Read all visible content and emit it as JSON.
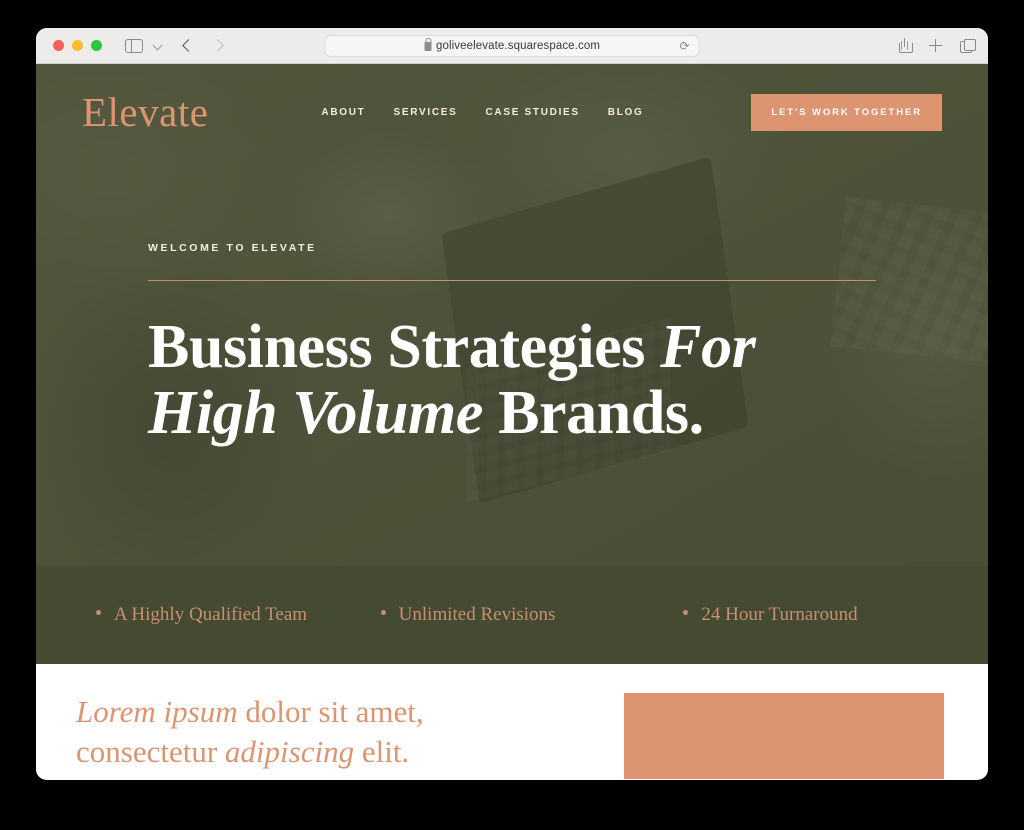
{
  "browser": {
    "traffic_lights": [
      "close",
      "minimize",
      "maximize"
    ],
    "sidebar_toggle": "sidebar-icon",
    "tab_overview_chevron": "chevron-down-icon",
    "back": "back-arrow-icon",
    "forward": "forward-arrow-icon",
    "url": "goliveelevate.squarespace.com",
    "lock": "lock-icon",
    "reload": "⟳",
    "share": "share-icon",
    "new_tab": "plus-icon",
    "tabs": "tab-overview-icon"
  },
  "site": {
    "brand": "Elevate",
    "nav": [
      {
        "label": "ABOUT"
      },
      {
        "label": "SERVICES"
      },
      {
        "label": "CASE STUDIES"
      },
      {
        "label": "BLOG"
      }
    ],
    "cta": "LET'S WORK TOGETHER",
    "hero": {
      "eyebrow": "WELCOME TO ELEVATE",
      "headline_part1": "Business Strategies ",
      "headline_italic1": "For",
      "headline_italic2": "High Volume",
      "headline_part2": " Brands."
    },
    "features": [
      {
        "label": "A Highly Qualified Team"
      },
      {
        "label": "Unlimited Revisions"
      },
      {
        "label": "24 Hour Turnaround"
      }
    ],
    "lower": {
      "italic1": "Lorem ipsum",
      "text1": " dolor sit amet, consectetur ",
      "italic2": "adipiscing",
      "text2": " elit."
    }
  },
  "colors": {
    "brand_salmon": "#dd9470",
    "feature_salmon": "#c98e70",
    "hero_olive": "#4c5139",
    "bar_olive": "#454a33",
    "white": "#ffffff",
    "toolbar_grey": "#edeceb"
  }
}
